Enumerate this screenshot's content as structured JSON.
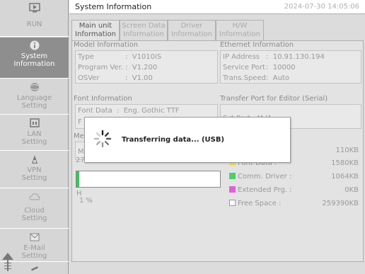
{
  "sidebar": {
    "items": [
      {
        "label": "RUN",
        "icon": "monitor-icon",
        "active": false
      },
      {
        "label": "System\nInformation",
        "icon": "info-icon",
        "active": true
      },
      {
        "label": "Language\nSetting",
        "icon": "globe-icon",
        "active": false
      },
      {
        "label": "LAN\nSetting",
        "icon": "lan-icon",
        "active": false
      },
      {
        "label": "VPN\nSetting",
        "icon": "vpn-icon",
        "active": false
      },
      {
        "label": "Cloud\nSetting",
        "icon": "cloud-icon",
        "active": false
      },
      {
        "label": "E-Mail\nSetting",
        "icon": "email-icon",
        "active": false
      }
    ]
  },
  "header": {
    "title": "System Information",
    "datetime": "2024-07-30  14:05:06"
  },
  "tabs": [
    {
      "label": "Main unit\nInformation",
      "active": true
    },
    {
      "label": "Screen Data\nInformation",
      "active": false
    },
    {
      "label": "Driver\nInformation",
      "active": false
    },
    {
      "label": "H/W\nInformation",
      "active": false
    }
  ],
  "model": {
    "heading": "Model Information",
    "type_label": "Type",
    "type_value": "V1010iS",
    "prog_label": "Program Ver.",
    "prog_value": "V1.200",
    "os_label": "OSVer",
    "os_value": "V1.00"
  },
  "ethernet": {
    "heading": "Ethernet Information",
    "ip_label": "IP Address",
    "ip_value": "10.91.130.194",
    "port_label": "Service Port",
    "port_value": "10000",
    "speed_label": "Trans.Speed",
    "speed_value": "Auto"
  },
  "font": {
    "heading": "Font Information",
    "data_label": "Font Data",
    "data_value": "Eng. Gothic TTF",
    "partial": "F"
  },
  "transfer": {
    "heading": "Transfer Port for Editor (Serial)",
    "port_partial": "Sct Port  :  M J1"
  },
  "memory": {
    "heading_partial": "Me",
    "row_partial": "M",
    "usage_text": "2734/262144KB",
    "percent_label": "1 %",
    "h_partial": "H",
    "used_fraction": 0.01,
    "legend": [
      {
        "label": "",
        "value": "110KB",
        "color": "#e9e9e9"
      },
      {
        "label": "Font Data  :",
        "value": "1580KB",
        "color": "#f2e24a"
      },
      {
        "label": "Comm. Driver :",
        "value": "1064KB",
        "color": "#4cd06a"
      },
      {
        "label": "Extended Prg. :",
        "value": "0KB",
        "color": "#e060d8"
      },
      {
        "label": "Free Space   :",
        "value": "259390KB",
        "color": "#ffffff"
      }
    ]
  },
  "dialog": {
    "message": "Transferring data... (USB)"
  }
}
